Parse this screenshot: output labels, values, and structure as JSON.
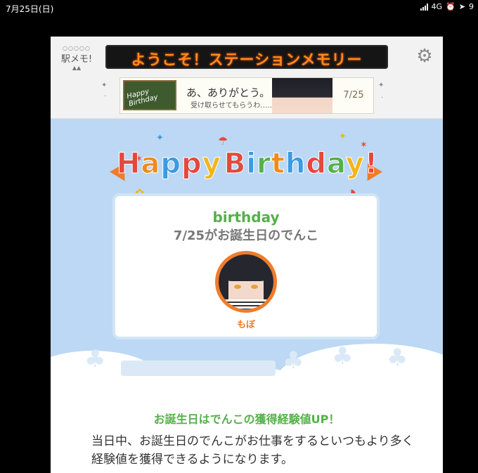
{
  "status_bar": {
    "date": "7月25日(日)",
    "network": "4G",
    "signal_icon": "signal-bars-icon",
    "alarm_icon": "alarm-icon",
    "location_icon": "location-arrow-icon",
    "extra": "9"
  },
  "header": {
    "logo_text": "駅メモ!",
    "marquee_text": "ようこそ！ステーションメモリー",
    "settings_icon": "gear-icon",
    "banner": {
      "board_text": "Happy Birthday",
      "thanks_text": "あ、ありがとう。",
      "sub_text": "受け取らせてもらうわ……",
      "date": "7/25"
    }
  },
  "hero": {
    "title_letters": [
      "H",
      "a",
      "p",
      "p",
      "y",
      " ",
      "B",
      "i",
      "r",
      "t",
      "h",
      "d",
      "a",
      "y",
      "!"
    ],
    "letter_colors": [
      "#e4483d",
      "#f08a1c",
      "#3c9ae0",
      "#e4483d",
      "#f2b51a",
      "",
      "#e4483d",
      "#3c9ae0",
      "#55b04a",
      "#f08a1c",
      "#3c9ae0",
      "#e4483d",
      "#55b04a",
      "#f2b51a",
      "#e4483d"
    ]
  },
  "card": {
    "title": "birthday",
    "subtitle": "7/25がお誕生日のでんこ",
    "character_name": "もぼ"
  },
  "info": {
    "heading": "お誕生日はでんこの獲得経験値UP！",
    "body": "当日中、お誕生日のでんこがお仕事をするといつもより多く経験値を獲得できるようになります。"
  },
  "colors": {
    "accent_orange": "#ef7c2a",
    "accent_green": "#55b04a",
    "sky": "#bcd8f4",
    "marquee_text": "#ff8a1c"
  }
}
